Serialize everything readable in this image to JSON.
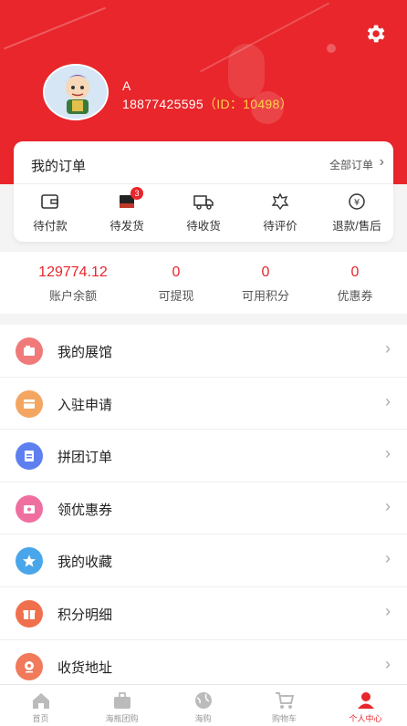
{
  "user": {
    "name": "A",
    "phone": "18877425595",
    "id_text": "（ID：10498）"
  },
  "orders": {
    "title": "我的订单",
    "all_label": "全部订单",
    "items": [
      {
        "label": "待付款",
        "icon": "wallet-icon"
      },
      {
        "label": "待发货",
        "icon": "package-icon",
        "badge": "3"
      },
      {
        "label": "待收货",
        "icon": "truck-icon"
      },
      {
        "label": "待评价",
        "icon": "comment-icon"
      },
      {
        "label": "退款/售后",
        "icon": "refund-icon"
      }
    ]
  },
  "stats": [
    {
      "value": "129774.12",
      "label": "账户余额"
    },
    {
      "value": "0",
      "label": "可提现"
    },
    {
      "value": "0",
      "label": "可用积分"
    },
    {
      "value": "0",
      "label": "优惠券"
    }
  ],
  "menu": [
    {
      "label": "我的展馆",
      "icon": "gallery-icon",
      "color": "#f07a7a"
    },
    {
      "label": "入驻申请",
      "icon": "store-icon",
      "color": "#f4a661"
    },
    {
      "label": "拼团订单",
      "icon": "group-order-icon",
      "color": "#5d7ff0"
    },
    {
      "label": "领优惠券",
      "icon": "coupon-icon",
      "color": "#f06fa1"
    },
    {
      "label": "我的收藏",
      "icon": "star-icon",
      "color": "#4aa6ea"
    },
    {
      "label": "积分明细",
      "icon": "gift-icon",
      "color": "#f0704d"
    },
    {
      "label": "收货地址",
      "icon": "location-icon",
      "color": "#f07a5a"
    }
  ],
  "tabs": [
    {
      "label": "首页",
      "icon": "home-icon"
    },
    {
      "label": "海瓶团购",
      "icon": "briefcase-icon"
    },
    {
      "label": "海购",
      "icon": "globe-icon"
    },
    {
      "label": "购物车",
      "icon": "cart-icon"
    },
    {
      "label": "个人中心",
      "icon": "person-icon",
      "active": true
    }
  ],
  "colors": {
    "brand": "#e8262b",
    "id_highlight": "#ffd24a"
  }
}
